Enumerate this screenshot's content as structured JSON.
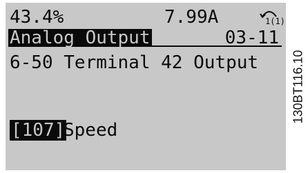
{
  "status": {
    "current_percent": "43.4%",
    "current_amps": "7.99A",
    "active_setup": "1(1)"
  },
  "menu": {
    "group_title": "Analog Output",
    "group_id": "03-11"
  },
  "parameter": {
    "label": "6-50 Terminal 42 Output"
  },
  "value": {
    "index": "[107]",
    "text": "Speed"
  },
  "figure_code": "130BT116.10"
}
